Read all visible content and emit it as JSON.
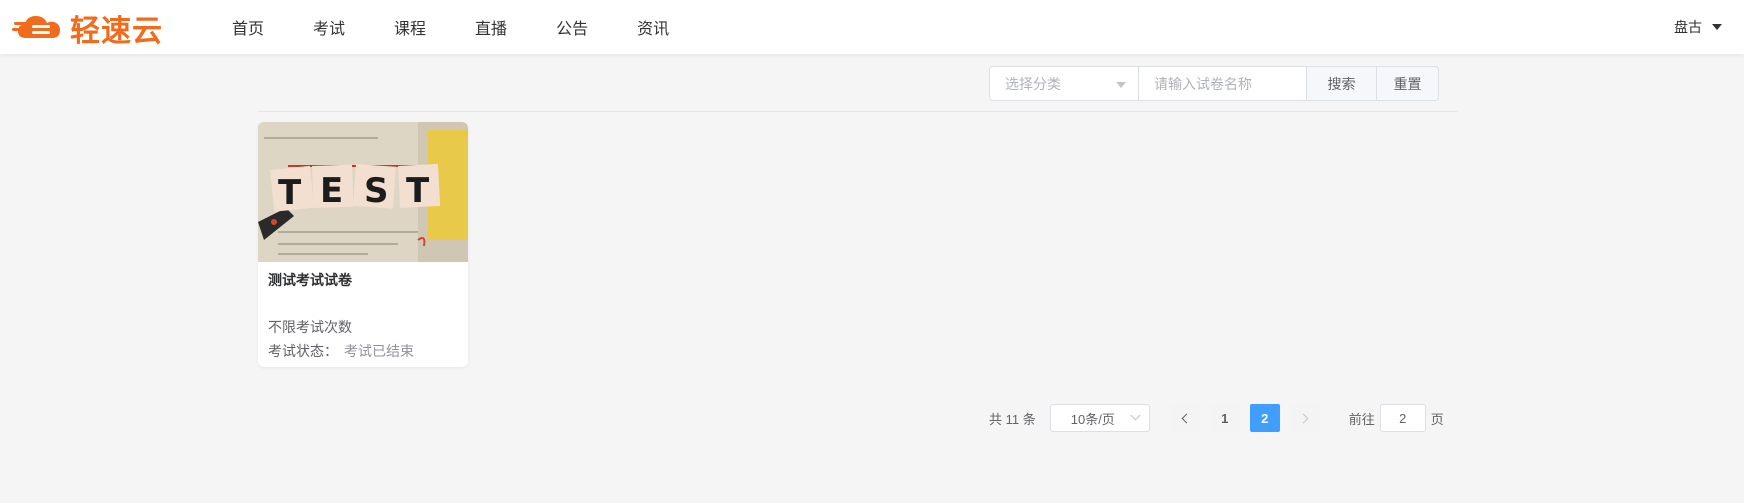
{
  "brand": {
    "name": "轻速云",
    "color": "#f26b1d",
    "icon": "cloud-logo-icon"
  },
  "nav": {
    "items": [
      "首页",
      "考试",
      "课程",
      "直播",
      "公告",
      "资讯"
    ]
  },
  "user": {
    "name": "盘古",
    "icon": "caret-down-icon"
  },
  "filter": {
    "category_placeholder": "选择分类",
    "name_placeholder": "请输入试卷名称",
    "search_label": "搜索",
    "reset_label": "重置"
  },
  "exams": [
    {
      "thumbnail_text": "TEST",
      "title": "测试考试试卷",
      "attempts": "不限考试次数",
      "status_label": "考试状态：",
      "status_value": "考试已结束"
    }
  ],
  "pagination": {
    "total": "共 11 条",
    "page_size": "10条/页",
    "pages": [
      "1",
      "2"
    ],
    "current": "2",
    "goto_label": "前往",
    "goto_value": "2",
    "page_suffix": "页"
  },
  "colors": {
    "accent": "#409eff",
    "background": "#f5f5f5"
  }
}
